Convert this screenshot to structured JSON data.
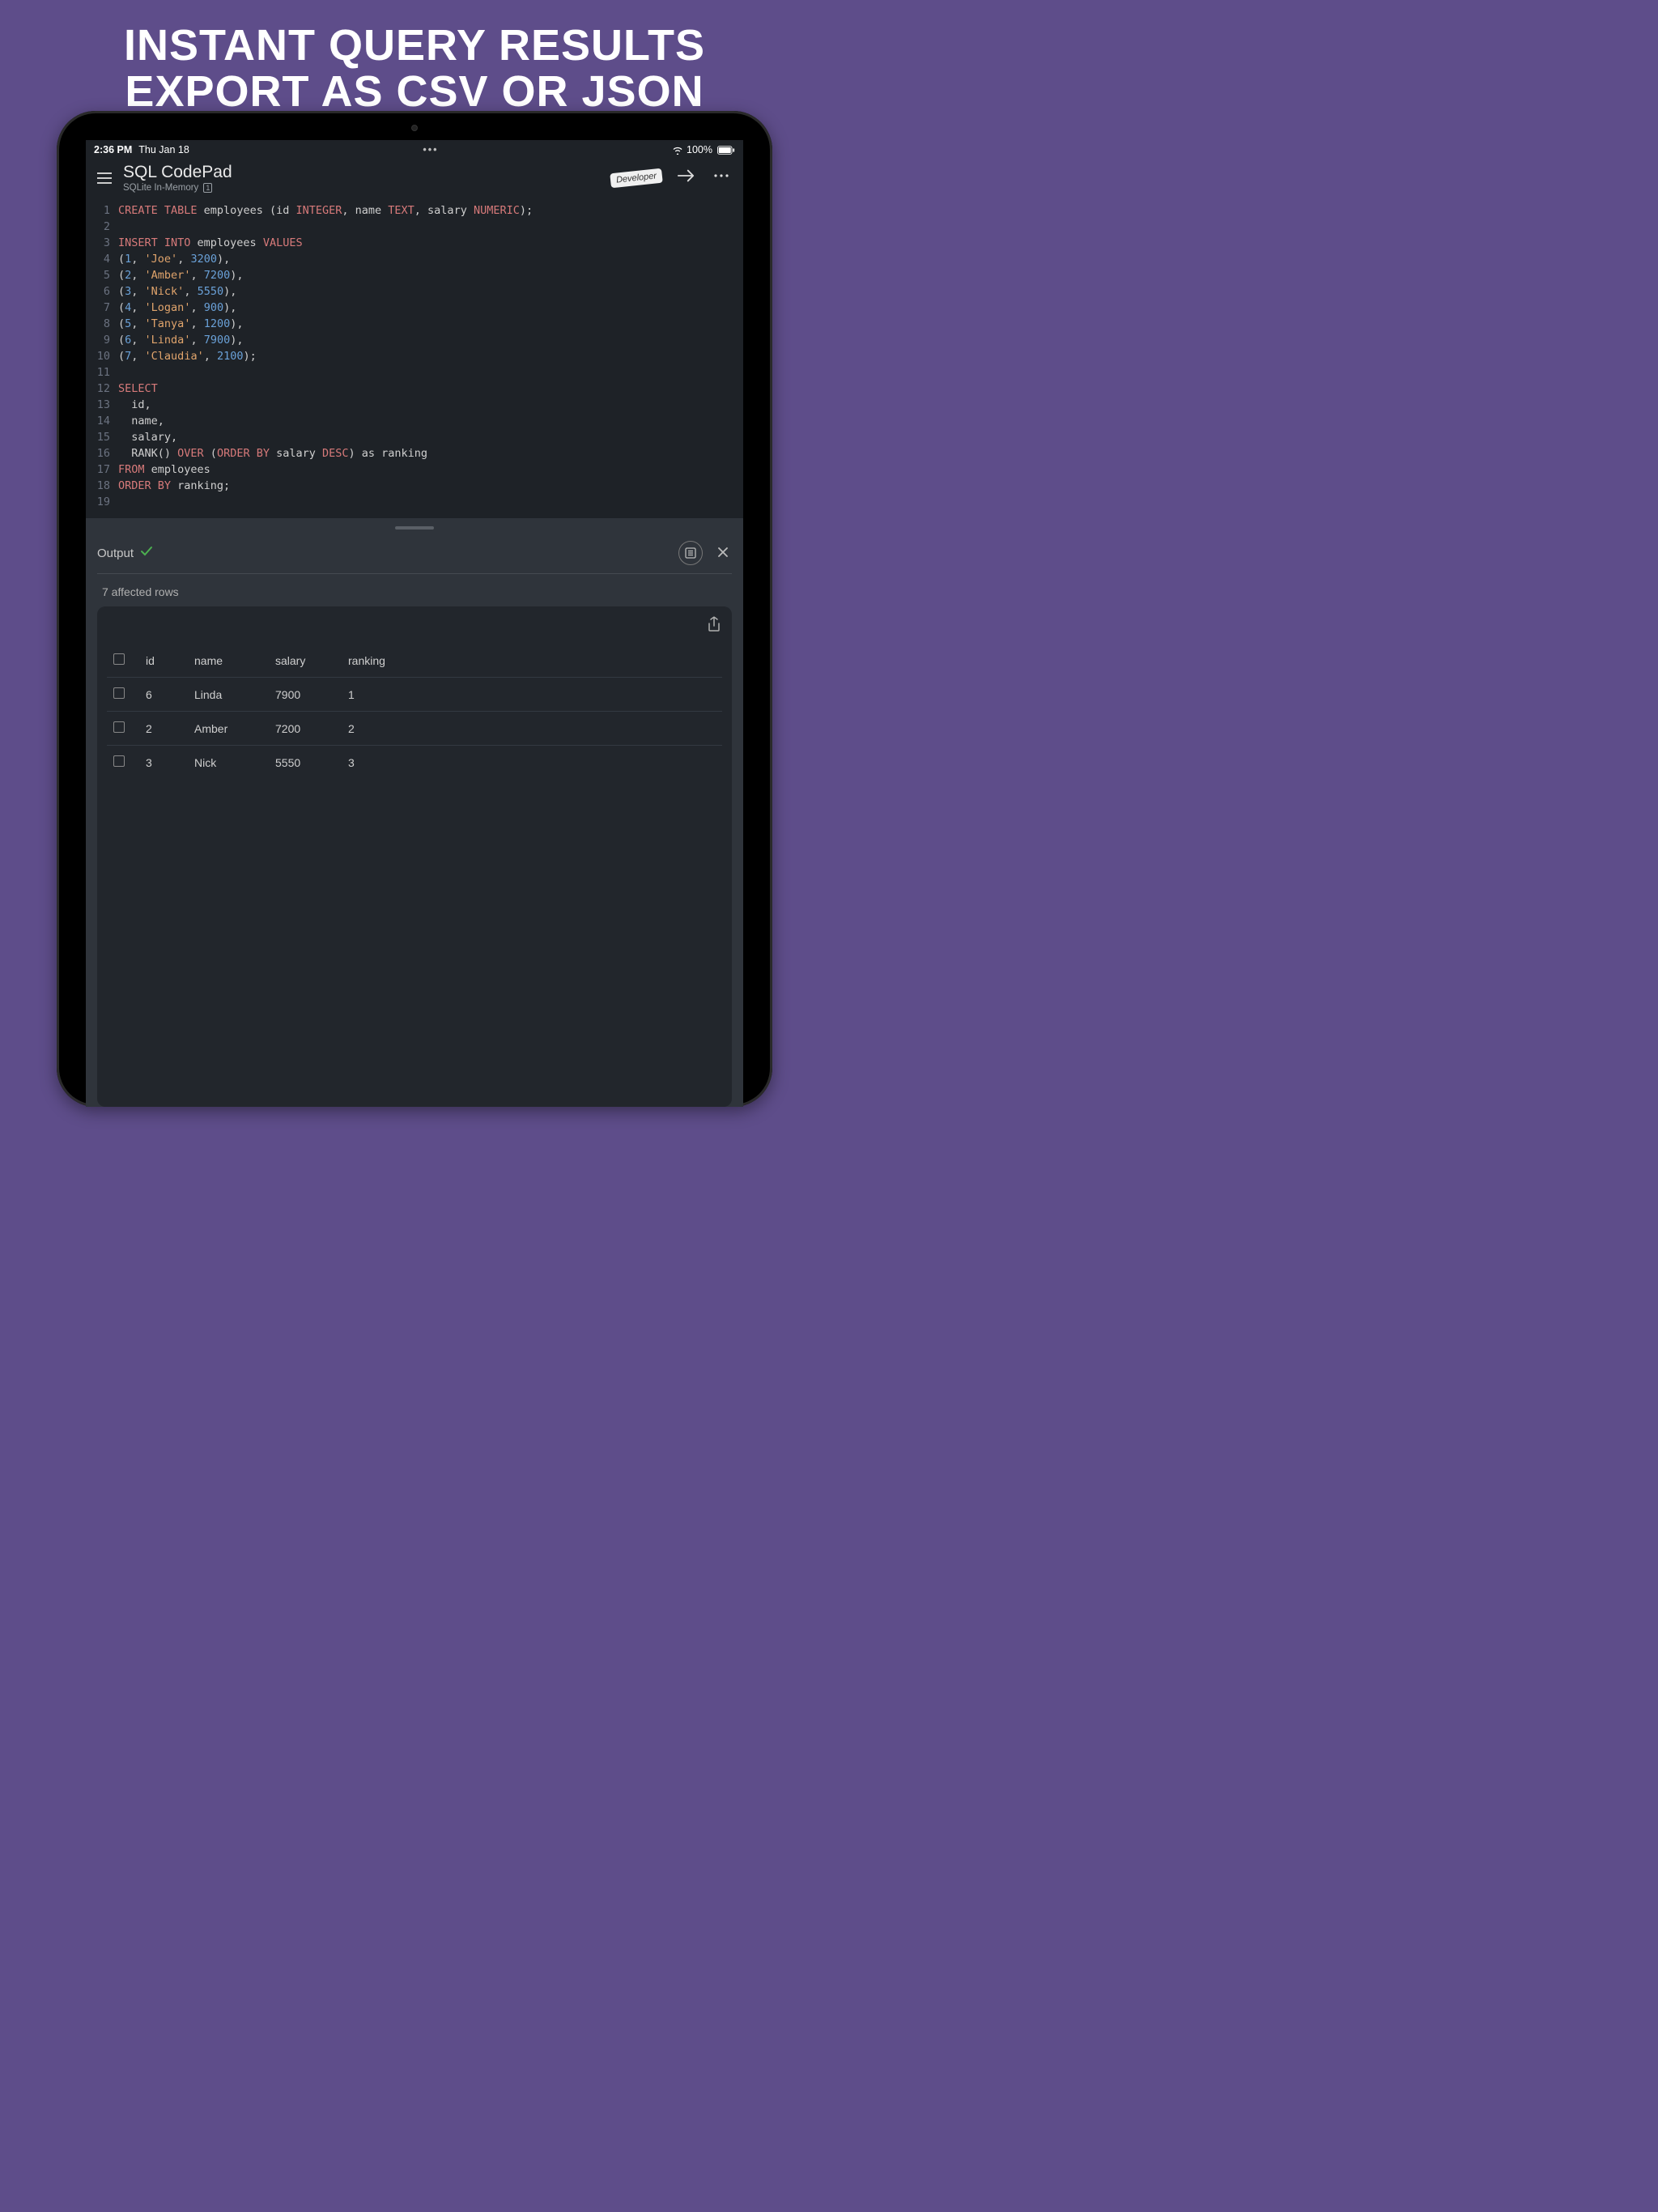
{
  "promo": {
    "line1": "INSTANT QUERY RESULTS",
    "line2": "EXPORT AS CSV OR JSON"
  },
  "status": {
    "time": "2:36 PM",
    "date": "Thu Jan 18",
    "center": "•••",
    "battery": "100%"
  },
  "header": {
    "title": "SQL CodePad",
    "subtitle": "SQLite In-Memory",
    "tab_count": "1",
    "dev_badge": "Developer"
  },
  "code": [
    [
      {
        "t": "kw",
        "v": "CREATE TABLE"
      },
      {
        "t": "txt",
        "v": " employees (id "
      },
      {
        "t": "kw",
        "v": "INTEGER"
      },
      {
        "t": "txt",
        "v": ", name "
      },
      {
        "t": "kw",
        "v": "TEXT"
      },
      {
        "t": "txt",
        "v": ", salary "
      },
      {
        "t": "kw",
        "v": "NUMERIC"
      },
      {
        "t": "txt",
        "v": ");"
      }
    ],
    [],
    [
      {
        "t": "kw",
        "v": "INSERT INTO"
      },
      {
        "t": "txt",
        "v": " employees "
      },
      {
        "t": "kw",
        "v": "VALUES"
      }
    ],
    [
      {
        "t": "txt",
        "v": "("
      },
      {
        "t": "num",
        "v": "1"
      },
      {
        "t": "txt",
        "v": ", "
      },
      {
        "t": "str",
        "v": "'Joe'"
      },
      {
        "t": "txt",
        "v": ", "
      },
      {
        "t": "num",
        "v": "3200"
      },
      {
        "t": "txt",
        "v": "),"
      }
    ],
    [
      {
        "t": "txt",
        "v": "("
      },
      {
        "t": "num",
        "v": "2"
      },
      {
        "t": "txt",
        "v": ", "
      },
      {
        "t": "str",
        "v": "'Amber'"
      },
      {
        "t": "txt",
        "v": ", "
      },
      {
        "t": "num",
        "v": "7200"
      },
      {
        "t": "txt",
        "v": "),"
      }
    ],
    [
      {
        "t": "txt",
        "v": "("
      },
      {
        "t": "num",
        "v": "3"
      },
      {
        "t": "txt",
        "v": ", "
      },
      {
        "t": "str",
        "v": "'Nick'"
      },
      {
        "t": "txt",
        "v": ", "
      },
      {
        "t": "num",
        "v": "5550"
      },
      {
        "t": "txt",
        "v": "),"
      }
    ],
    [
      {
        "t": "txt",
        "v": "("
      },
      {
        "t": "num",
        "v": "4"
      },
      {
        "t": "txt",
        "v": ", "
      },
      {
        "t": "str",
        "v": "'Logan'"
      },
      {
        "t": "txt",
        "v": ", "
      },
      {
        "t": "num",
        "v": "900"
      },
      {
        "t": "txt",
        "v": "),"
      }
    ],
    [
      {
        "t": "txt",
        "v": "("
      },
      {
        "t": "num",
        "v": "5"
      },
      {
        "t": "txt",
        "v": ", "
      },
      {
        "t": "str",
        "v": "'Tanya'"
      },
      {
        "t": "txt",
        "v": ", "
      },
      {
        "t": "num",
        "v": "1200"
      },
      {
        "t": "txt",
        "v": "),"
      }
    ],
    [
      {
        "t": "txt",
        "v": "("
      },
      {
        "t": "num",
        "v": "6"
      },
      {
        "t": "txt",
        "v": ", "
      },
      {
        "t": "str",
        "v": "'Linda'"
      },
      {
        "t": "txt",
        "v": ", "
      },
      {
        "t": "num",
        "v": "7900"
      },
      {
        "t": "txt",
        "v": "),"
      }
    ],
    [
      {
        "t": "txt",
        "v": "("
      },
      {
        "t": "num",
        "v": "7"
      },
      {
        "t": "txt",
        "v": ", "
      },
      {
        "t": "str",
        "v": "'Claudia'"
      },
      {
        "t": "txt",
        "v": ", "
      },
      {
        "t": "num",
        "v": "2100"
      },
      {
        "t": "txt",
        "v": ");"
      }
    ],
    [],
    [
      {
        "t": "kw",
        "v": "SELECT"
      }
    ],
    [
      {
        "t": "txt",
        "v": "  id,"
      }
    ],
    [
      {
        "t": "txt",
        "v": "  name,"
      }
    ],
    [
      {
        "t": "txt",
        "v": "  salary,"
      }
    ],
    [
      {
        "t": "txt",
        "v": "  RANK() "
      },
      {
        "t": "kw",
        "v": "OVER"
      },
      {
        "t": "txt",
        "v": " ("
      },
      {
        "t": "kw",
        "v": "ORDER BY"
      },
      {
        "t": "txt",
        "v": " salary "
      },
      {
        "t": "kw",
        "v": "DESC"
      },
      {
        "t": "txt",
        "v": ") as ranking"
      }
    ],
    [
      {
        "t": "kw",
        "v": "FROM"
      },
      {
        "t": "txt",
        "v": " employees"
      }
    ],
    [
      {
        "t": "kw",
        "v": "ORDER BY"
      },
      {
        "t": "txt",
        "v": " ranking;"
      }
    ],
    []
  ],
  "output": {
    "label": "Output",
    "affected": "7 affected rows",
    "columns": [
      "id",
      "name",
      "salary",
      "ranking"
    ],
    "rows": [
      {
        "id": "6",
        "name": "Linda",
        "salary": "7900",
        "ranking": "1"
      },
      {
        "id": "2",
        "name": "Amber",
        "salary": "7200",
        "ranking": "2"
      },
      {
        "id": "3",
        "name": "Nick",
        "salary": "5550",
        "ranking": "3"
      }
    ]
  }
}
